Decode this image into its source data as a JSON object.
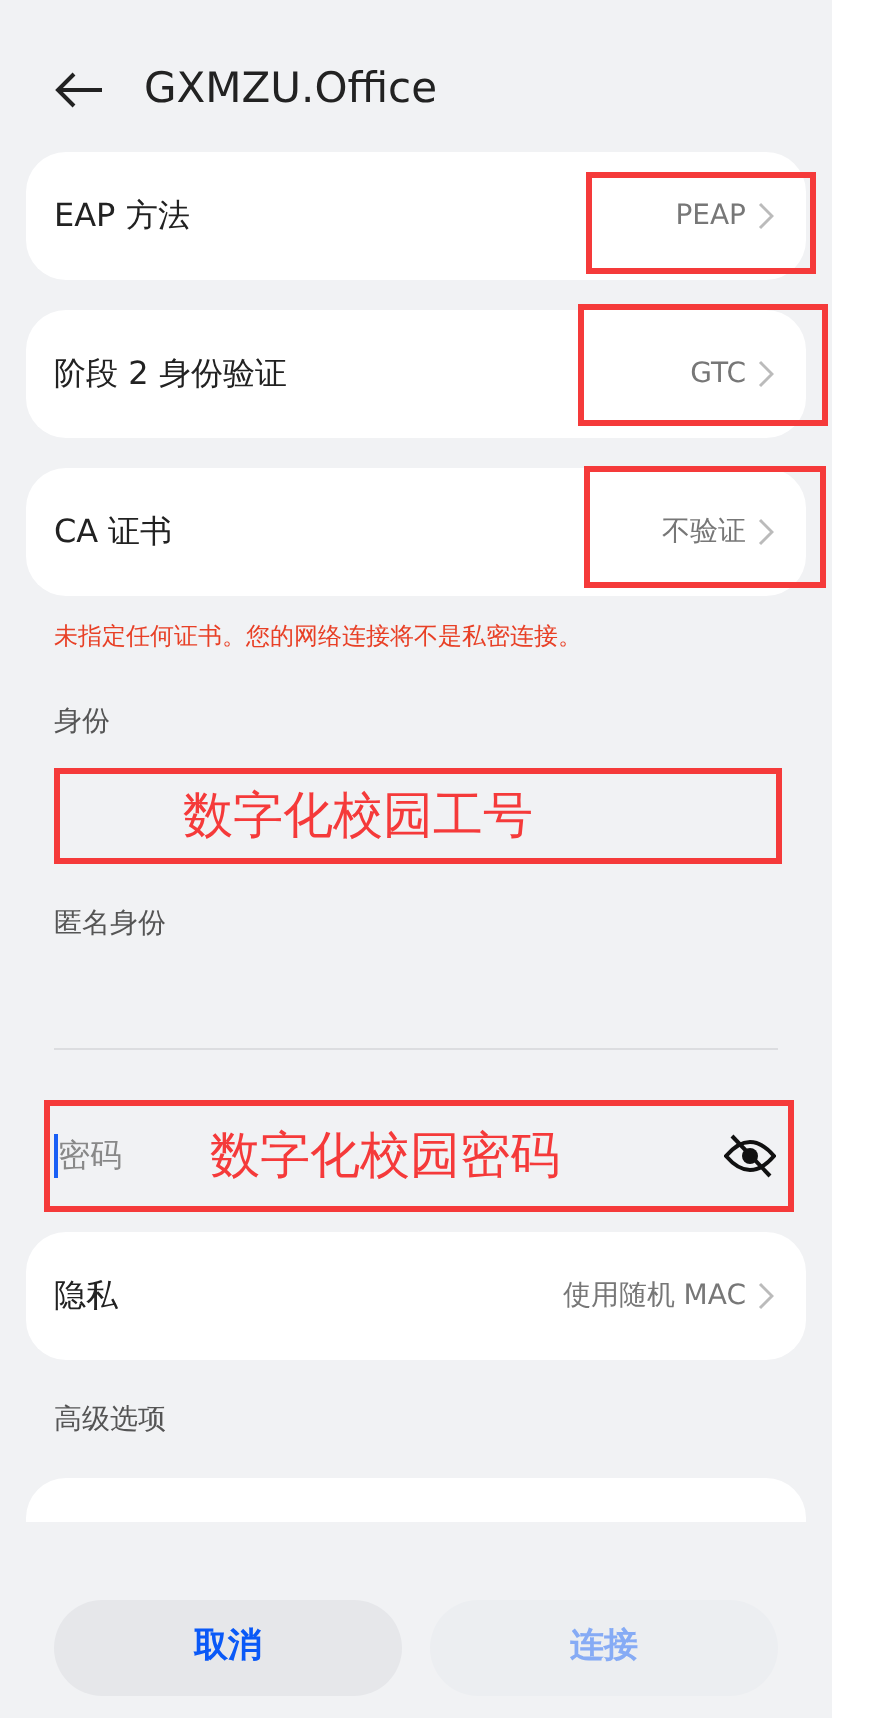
{
  "header": {
    "title": "GXMZU.Office"
  },
  "settings": [
    {
      "label": "EAP 方法",
      "value": "PEAP",
      "annotated": true
    },
    {
      "label": "阶段 2 身份验证",
      "value": "GTC",
      "annotated": true
    },
    {
      "label": "CA 证书",
      "value": "不验证",
      "annotated": true
    }
  ],
  "warning": "未指定任何证书。您的网络连接将不是私密连接。",
  "identity": {
    "label": "身份",
    "annotation": "数字化校园工号"
  },
  "anonymous_identity": {
    "label": "匿名身份"
  },
  "password": {
    "placeholder": "密码",
    "annotation": "数字化校园密码",
    "visible": false
  },
  "privacy": {
    "label": "隐私",
    "value": "使用随机 MAC"
  },
  "advanced": {
    "label": "高级选项"
  },
  "buttons": [
    {
      "label": "取消",
      "disabled": false
    },
    {
      "label": "连接",
      "disabled": true
    }
  ]
}
